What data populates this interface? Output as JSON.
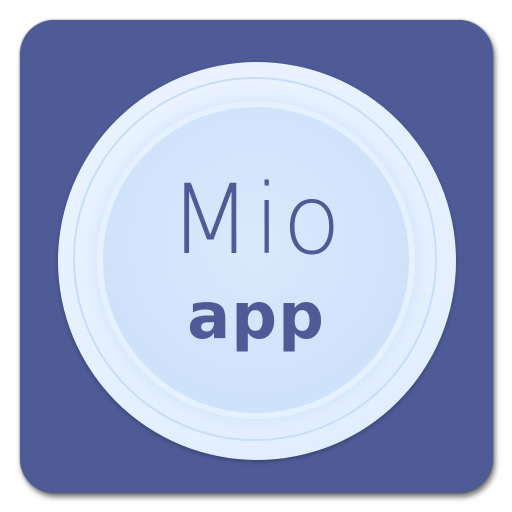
{
  "icon": {
    "title": "Mio",
    "subtitle": "app",
    "colors": {
      "tile": "#4e5b97",
      "circle": "#d9e9fd",
      "text": "#4e5b97"
    }
  }
}
